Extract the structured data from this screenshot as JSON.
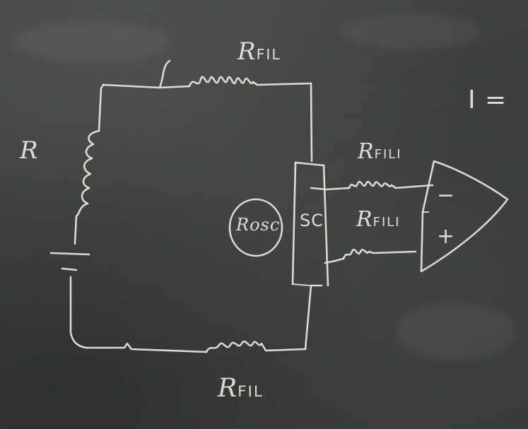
{
  "board": {
    "labels": {
      "r_fil_top": {
        "main": "R",
        "sub": "FIL"
      },
      "r_left": "R",
      "r_fil_mid_top": {
        "main": "R",
        "sub": "FILI"
      },
      "r_fil_mid_bottom": {
        "main": "R",
        "sub": "FILI"
      },
      "r_osc": "Rosc",
      "sc": "SC",
      "r_fil_bottom": {
        "main": "R",
        "sub": "FIL"
      },
      "current": "I =",
      "opamp_minus": "−",
      "opamp_plus": "+"
    }
  }
}
